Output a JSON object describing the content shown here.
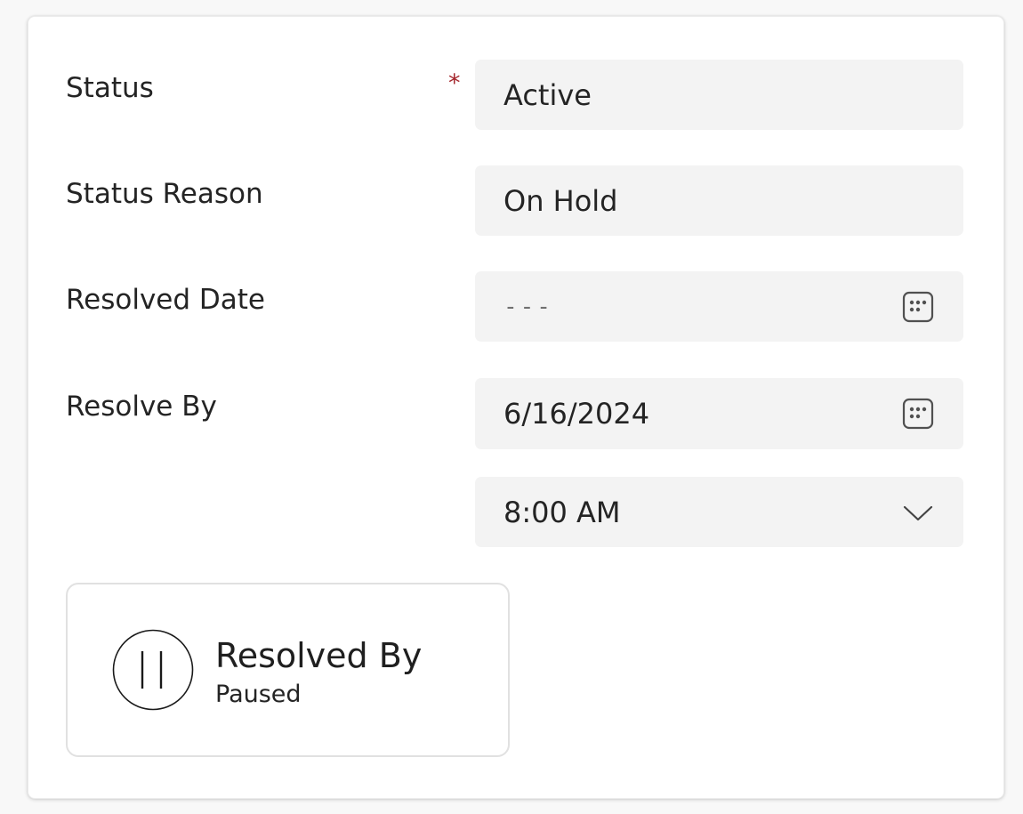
{
  "form": {
    "status": {
      "label": "Status",
      "required_marker": "*",
      "value": "Active"
    },
    "status_reason": {
      "label": "Status Reason",
      "value": "On Hold"
    },
    "resolved_date": {
      "label": "Resolved Date",
      "value": "---",
      "icon": "calendar-icon"
    },
    "resolve_by": {
      "label": "Resolve By",
      "date_value": "6/16/2024",
      "date_icon": "calendar-icon",
      "time_value": "8:00 AM",
      "time_icon": "chevron-down-icon"
    }
  },
  "timer": {
    "title": "Resolved By",
    "state": "Paused",
    "icon": "pause-icon"
  },
  "colors": {
    "required": "#a4262c",
    "field_background": "#f3f3f3",
    "card_background": "#ffffff",
    "page_background": "#f8f8f8"
  }
}
